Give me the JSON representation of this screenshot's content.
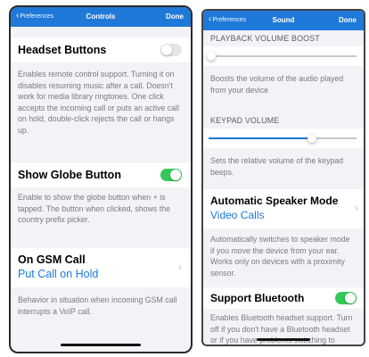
{
  "left_screen": {
    "nav": {
      "back_label": "Preferences",
      "title": "Controls",
      "done_label": "Done"
    },
    "headset": {
      "label": "Headset Buttons",
      "toggle": "off",
      "description": "Enables remote control support. Turning it on disables resuming music after a call. Doesn't work for media library ringtones. One click accepts the incoming call or puts an active call on hold, double-click rejects the call or hangs up."
    },
    "globe": {
      "label": "Show Globe Button",
      "toggle": "on",
      "description": "Enable to show the globe button when + is tapped. The button when clicked, shows the country prefix picker."
    },
    "gsm": {
      "label": "On GSM Call",
      "value": "Put Call on Hold",
      "description": "Behavior in situation when incoming GSM call interrupts a VoIP call."
    }
  },
  "right_screen": {
    "nav": {
      "back_label": "Preferences",
      "title": "Sound",
      "done_label": "Done"
    },
    "playback": {
      "header": "PLAYBACK VOLUME BOOST",
      "level": 0.02,
      "description": "Boosts the volume of the audio played from your device"
    },
    "keypad": {
      "header": "KEYPAD VOLUME",
      "level": 0.7,
      "description": "Sets the relative volume of the keypad beeps."
    },
    "speaker": {
      "label": "Automatic Speaker Mode",
      "value": "Video Calls",
      "description": "Automatically switches to speaker mode if you move the device from your ear. Works only on devices with a proximity sensor."
    },
    "bluetooth": {
      "label": "Support Bluetooth",
      "toggle": "on",
      "description": "Enables Bluetooth headset support. Turn off if you don't have a Bluetooth headset or if you have problems switching to"
    }
  },
  "colors": {
    "accent": "#1f79d8",
    "toggle_on": "#34c759",
    "toggle_off": "#e5e5ea"
  }
}
